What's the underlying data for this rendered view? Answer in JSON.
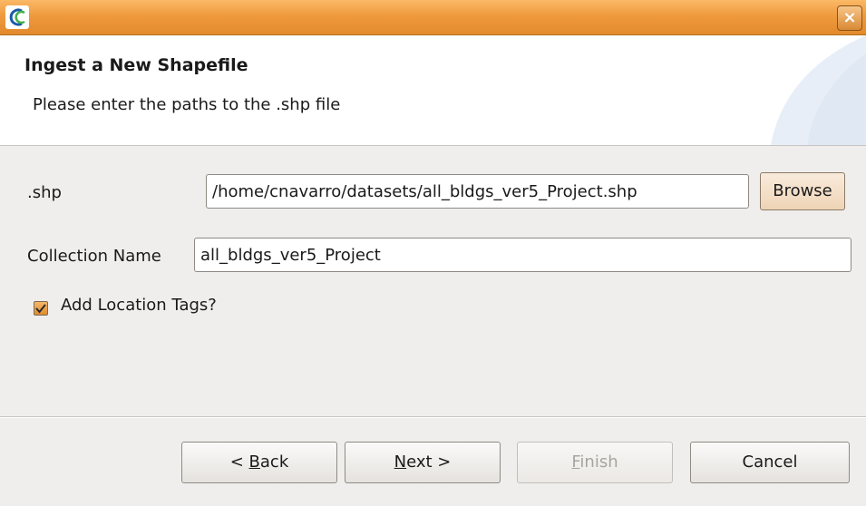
{
  "window": {
    "close_glyph": "×"
  },
  "header": {
    "title": "Ingest a New Shapefile",
    "description": "Please enter the paths to the .shp file"
  },
  "form": {
    "shp_label": ".shp",
    "shp_value": "/home/cnavarro/datasets/all_bldgs_ver5_Project.shp",
    "browse_label": "Browse",
    "collection_label": "Collection Name",
    "collection_value": "all_bldgs_ver5_Project",
    "location_tags_label": "Add Location Tags?",
    "location_tags_checked": true
  },
  "buttons": {
    "back": {
      "prefix": "< ",
      "mnemonic": "B",
      "rest": "ack"
    },
    "next": {
      "mnemonic": "N",
      "rest": "ext >"
    },
    "finish": {
      "mnemonic": "F",
      "rest": "inish",
      "enabled": false
    },
    "cancel": "Cancel"
  },
  "icons": {
    "app": "app-logo-icon",
    "close": "close-icon",
    "check": "checkmark-icon"
  },
  "colors": {
    "titlebar": "#ef9a3e",
    "checkbox": "#e08c2e",
    "banner_arc": "#e3ebf5"
  }
}
